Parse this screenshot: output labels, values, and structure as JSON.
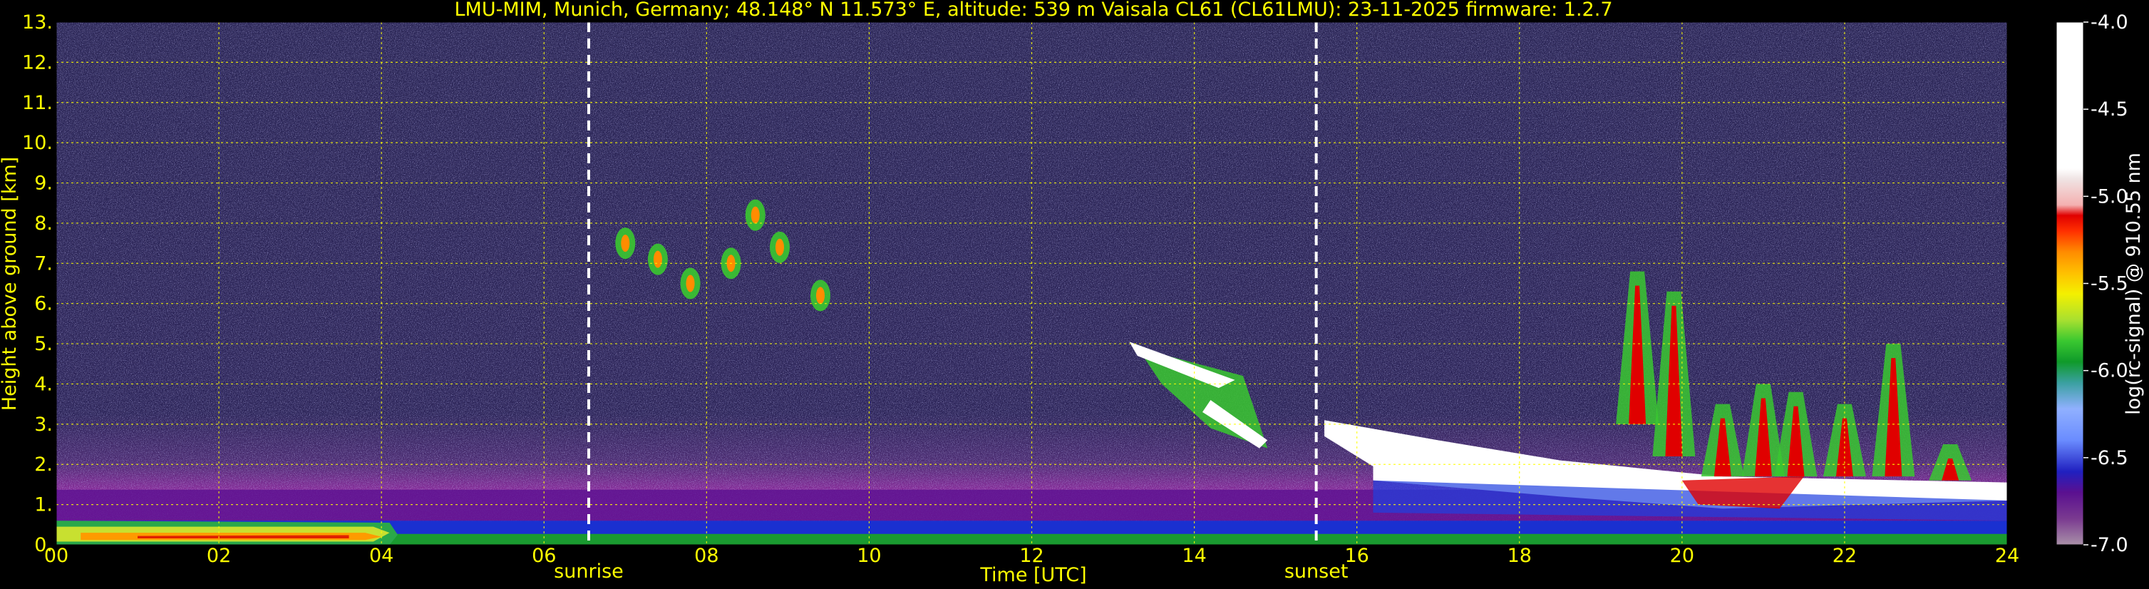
{
  "chart_data": {
    "type": "heatmap",
    "title": "LMU-MIM, Munich, Germany; 48.148° N 11.573° E, altitude: 539 m    Vaisala CL61 (CL61LMU): 23-11-2025    firmware: 1.2.7",
    "xlabel": "Time [UTC]",
    "ylabel": "Height above ground [km]",
    "colorbar_label": "log(rc-signal) @ 910.55 nm",
    "xlim": [
      0,
      24
    ],
    "ylim": [
      0,
      13
    ],
    "x_ticks": [
      0,
      2,
      4,
      6,
      8,
      10,
      12,
      14,
      16,
      18,
      20,
      22,
      24
    ],
    "x_tick_labels": [
      "00",
      "02",
      "04",
      "06",
      "08",
      "10",
      "12",
      "14",
      "16",
      "18",
      "20",
      "22",
      "24"
    ],
    "y_ticks": [
      0,
      1,
      2,
      3,
      4,
      5,
      6,
      7,
      8,
      9,
      10,
      11,
      12,
      13
    ],
    "y_tick_labels": [
      "0.",
      "1.",
      "2.",
      "3.",
      "4.",
      "5.",
      "6.",
      "7.",
      "8.",
      "9.",
      "10.",
      "11.",
      "12.",
      "13."
    ],
    "colorbar_range": [
      -7.0,
      -4.0
    ],
    "colorbar_ticks": [
      -7.0,
      -6.5,
      -6.0,
      -5.5,
      -5.0,
      -4.5,
      -4.0
    ],
    "colorbar_tick_labels": [
      "-7.0",
      "-6.5",
      "-6.0",
      "-5.5",
      "-5.0",
      "-4.5",
      "-4.0"
    ],
    "grid": true,
    "markers": [
      {
        "time": 6.55,
        "label": "sunrise"
      },
      {
        "time": 15.5,
        "label": "sunset"
      }
    ],
    "features": [
      {
        "name": "surface aerosol layer",
        "time": [
          0,
          24
        ],
        "height_km": [
          0,
          0.6
        ],
        "value": -5.8
      },
      {
        "name": "boundary layer",
        "time": [
          0,
          24
        ],
        "height_km": [
          0.6,
          2.0
        ],
        "value": -6.7
      },
      {
        "name": "cirrus",
        "time": [
          6.8,
          9.5
        ],
        "height_km": [
          6.0,
          8.4
        ],
        "value": -5.5
      },
      {
        "name": "mid-level cloud",
        "time": [
          13.2,
          14.9
        ],
        "height_km": [
          2.4,
          5.1
        ],
        "value": -4.0
      },
      {
        "name": "low cloud",
        "time": [
          15.5,
          24
        ],
        "height_km": [
          0.8,
          3.1
        ],
        "value": -4.0
      },
      {
        "name": "precipitation fallstreaks",
        "time": [
          19.3,
          23.8
        ],
        "height_km": [
          0.8,
          6.8
        ],
        "value": -5.3
      }
    ],
    "colors": {
      "background": "#000000",
      "text": "#ffff00",
      "colorbar_text": "#ffffff",
      "grid": "#ffff00",
      "marker": "#ffffff"
    }
  }
}
